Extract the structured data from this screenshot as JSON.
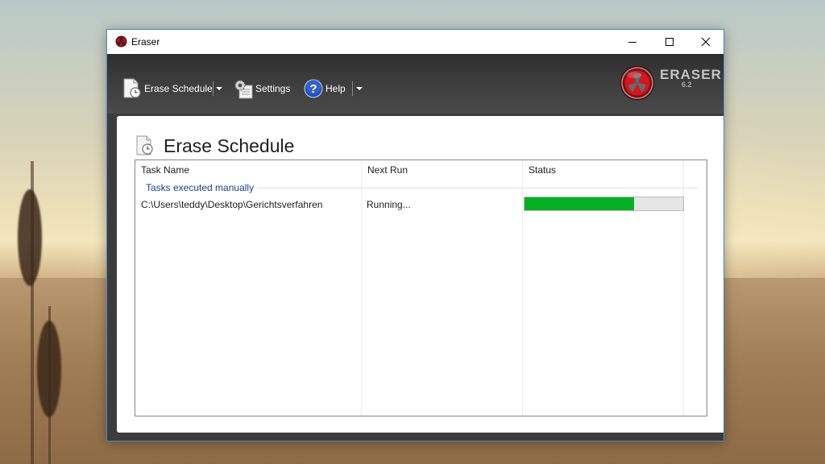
{
  "window": {
    "title": "Eraser"
  },
  "toolbar": {
    "erase_schedule_label": "Erase Schedule",
    "settings_label": "Settings",
    "help_label": "Help"
  },
  "brand": {
    "name": "ERASER",
    "version": "6.2"
  },
  "page": {
    "title": "Erase Schedule"
  },
  "table": {
    "columns": [
      "Task Name",
      "Next Run",
      "Status"
    ],
    "group_label": "Tasks executed manually",
    "rows": [
      {
        "task_name": "C:\\Users\\teddy\\Desktop\\Gerichtsverfahren",
        "next_run": "Running...",
        "progress": 0.69
      }
    ]
  },
  "colors": {
    "progress_fill": "#06b025",
    "toolbar_bg": "#3b3b3b",
    "group_label": "#1e3f8a",
    "brand_red": "#c0101a"
  },
  "icons": {
    "app": "eraser-logo-icon",
    "erase_schedule": "schedule-document-icon",
    "settings": "gear-icon",
    "help": "help-icon",
    "minimize": "minimize-icon",
    "maximize": "maximize-icon",
    "close": "close-icon"
  }
}
